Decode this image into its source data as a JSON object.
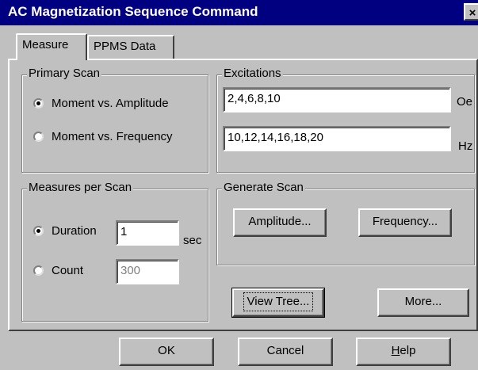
{
  "window": {
    "title": "AC Magnetization Sequence Command",
    "close_glyph": "×"
  },
  "tabs": [
    {
      "label": "Measure",
      "active": true
    },
    {
      "label": "PPMS Data",
      "active": false
    }
  ],
  "primary_scan": {
    "title": "Primary Scan",
    "options": [
      {
        "label": "Moment vs. Amplitude",
        "selected": true
      },
      {
        "label": "Moment vs. Frequency",
        "selected": false
      }
    ]
  },
  "excitations": {
    "title": "Excitations",
    "amplitude_value": "2,4,6,8,10",
    "amplitude_unit": "Oe",
    "frequency_value": "10,12,14,16,18,20",
    "frequency_unit": "Hz"
  },
  "measures_per_scan": {
    "title": "Measures per Scan",
    "duration_label": "Duration",
    "duration_selected": true,
    "duration_value": "1",
    "duration_unit": "sec",
    "count_label": "Count",
    "count_selected": false,
    "count_value": "300"
  },
  "generate_scan": {
    "title": "Generate Scan",
    "amplitude_button": "Amplitude...",
    "frequency_button": "Frequency..."
  },
  "actions": {
    "view_tree": "View Tree...",
    "more": "More..."
  },
  "footer": {
    "ok": "OK",
    "cancel": "Cancel",
    "help": "Help"
  }
}
